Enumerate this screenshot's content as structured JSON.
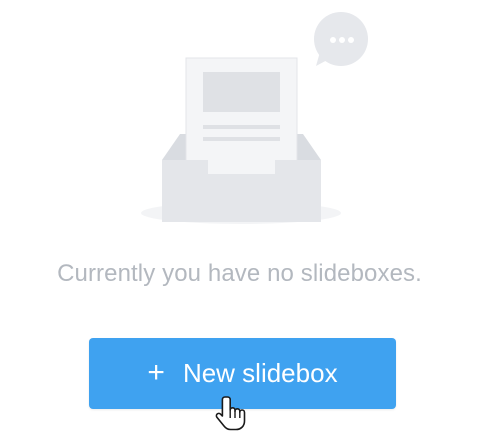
{
  "empty_state": {
    "message": "Currently you have no slideboxes."
  },
  "actions": {
    "new_button": {
      "icon": "plus-icon",
      "plus_glyph": "+",
      "label": "New slidebox"
    }
  },
  "icons": {
    "illustration": "empty-inbox-icon",
    "speech": "speech-bubble-icon",
    "cursor": "hand-pointer-icon"
  },
  "colors": {
    "button_bg": "#3fa2f0",
    "button_text": "#ffffff",
    "message_text": "#b3b8bf",
    "illustration_gray": "#e4e6ea",
    "illustration_light": "#f1f2f4"
  }
}
